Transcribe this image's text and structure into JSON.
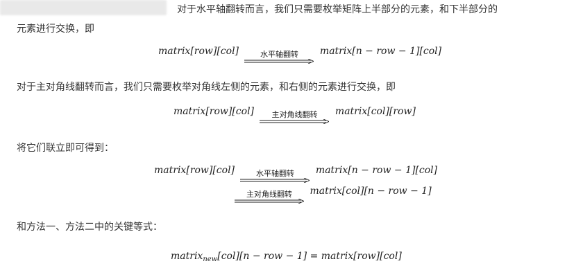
{
  "paragraphs": {
    "p1_line1": "对于水平轴翻转而言，我们只需要枚举矩阵上半部分的元素，和下半部分的",
    "p1_line2": "元素进行交换，即",
    "p2": "对于主对角线翻转而言，我们只需要枚举对角线左侧的元素，和右侧的元素进行交换，即",
    "p3": "将它们联立即可得到：",
    "p4": "和方法一、方法二中的关键等式："
  },
  "equations": {
    "eq1": {
      "lhs": "matrix[row][col]",
      "arrow": "水平轴翻转",
      "rhs": "matrix[n − row − 1][col]"
    },
    "eq2": {
      "lhs": "matrix[row][col]",
      "arrow": "主对角线翻转",
      "rhs": "matrix[col][row]"
    },
    "eq3": {
      "lhs": "matrix[row][col]",
      "arrow1": "水平轴翻转",
      "rhs1": "matrix[n − row − 1][col]",
      "arrow2": "主对角线翻转",
      "rhs2": "matrix[col][n − row − 1]"
    },
    "eq4": {
      "lhs_base": "matrix",
      "lhs_sub": "new",
      "lhs_idx": "[col][n − row − 1]",
      "eq": "=",
      "rhs": "matrix[row][col]"
    }
  }
}
